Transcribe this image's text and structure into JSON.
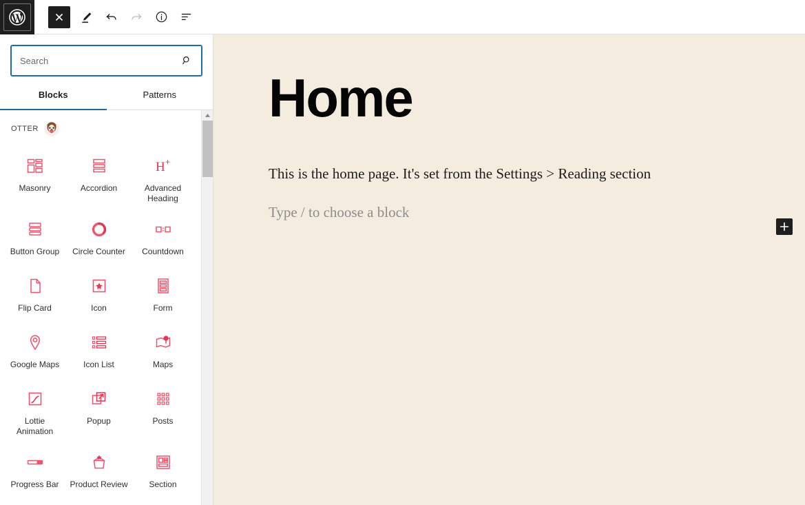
{
  "app": {
    "name": "WordPress Block Editor",
    "logo_icon": "wordpress-logo-icon"
  },
  "toolbar": {
    "items": [
      {
        "name": "close-inserter-button",
        "icon": "close-x-icon",
        "label": "Close block inserter",
        "style": "dark",
        "enabled": true
      },
      {
        "name": "edit-tool-button",
        "icon": "pencil-edit-icon",
        "label": "Edit",
        "style": "plain",
        "enabled": true
      },
      {
        "name": "undo-button",
        "icon": "undo-arrow-icon",
        "label": "Undo",
        "style": "plain",
        "enabled": true
      },
      {
        "name": "redo-button",
        "icon": "redo-arrow-icon",
        "label": "Redo",
        "style": "plain",
        "enabled": false
      },
      {
        "name": "details-button",
        "icon": "info-circle-icon",
        "label": "Details",
        "style": "plain",
        "enabled": true
      },
      {
        "name": "list-view-button",
        "icon": "list-view-icon",
        "label": "Document Overview",
        "style": "plain",
        "enabled": true
      }
    ]
  },
  "inserter": {
    "search": {
      "placeholder": "Search",
      "value": "",
      "icon": "search-magnifier-icon"
    },
    "tabs": [
      {
        "label": "Blocks",
        "active": true
      },
      {
        "label": "Patterns",
        "active": false
      }
    ],
    "category": {
      "title": "OTTER",
      "avatar_icon": "otter-avatar-icon"
    },
    "blocks": [
      {
        "label": "Masonry",
        "icon": "masonry-icon"
      },
      {
        "label": "Accordion",
        "icon": "accordion-icon"
      },
      {
        "label": "Advanced Heading",
        "icon": "advanced-heading-icon"
      },
      {
        "label": "Button Group",
        "icon": "button-group-icon"
      },
      {
        "label": "Circle Counter",
        "icon": "circle-counter-icon"
      },
      {
        "label": "Countdown",
        "icon": "countdown-icon"
      },
      {
        "label": "Flip Card",
        "icon": "flip-card-icon"
      },
      {
        "label": "Icon",
        "icon": "icon-star-icon"
      },
      {
        "label": "Form",
        "icon": "form-icon"
      },
      {
        "label": "Google Maps",
        "icon": "google-maps-pin-icon"
      },
      {
        "label": "Icon List",
        "icon": "icon-list-icon"
      },
      {
        "label": "Maps",
        "icon": "maps-icon"
      },
      {
        "label": "Lottie Animation",
        "icon": "lottie-animation-icon"
      },
      {
        "label": "Popup",
        "icon": "popup-icon"
      },
      {
        "label": "Posts",
        "icon": "posts-grid-icon"
      },
      {
        "label": "Progress Bar",
        "icon": "progress-bar-icon"
      },
      {
        "label": "Product Review",
        "icon": "product-review-icon"
      },
      {
        "label": "Section",
        "icon": "section-icon"
      }
    ],
    "scrollbar": {
      "up_arrow_icon": "scroll-up-arrow-icon"
    }
  },
  "canvas": {
    "title": "Home",
    "paragraph": "This is the home page. It's set from the Settings > Reading section",
    "placeholder": "Type / to choose a block",
    "add_block_label": "Add block",
    "add_block_icon": "plus-icon",
    "background_color": "#f3ecdf"
  },
  "colors": {
    "accent_blue": "#1e6ba1",
    "block_icon_pink": "#f06078",
    "block_icon_red": "#e8344e",
    "toolbar_dark": "#1e1e1e",
    "canvas_bg": "#f3ecdf"
  }
}
